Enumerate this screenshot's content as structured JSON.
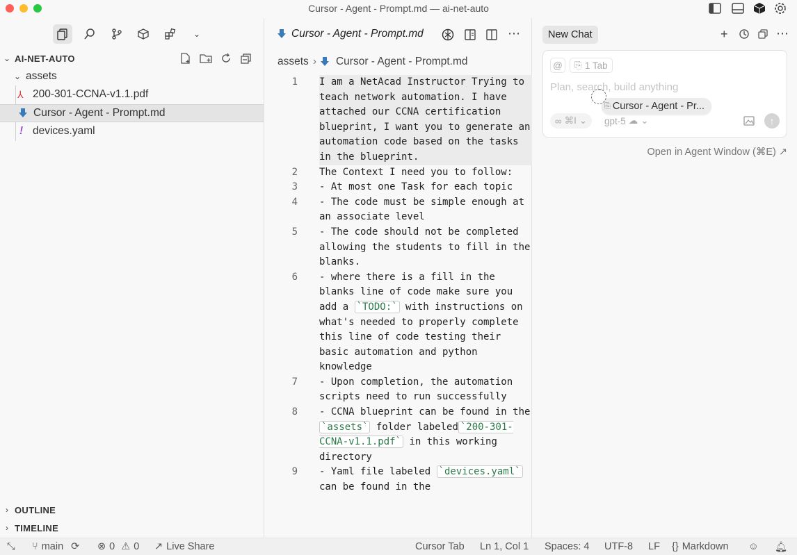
{
  "window": {
    "title": "Cursor - Agent - Prompt.md — ai-net-auto"
  },
  "sidebar": {
    "project": "AI-NET-AUTO",
    "tree": [
      {
        "label": "assets",
        "type": "folder"
      },
      {
        "label": "200-301-CCNA-v1.1.pdf",
        "type": "pdf"
      },
      {
        "label": "Cursor - Agent -  Prompt.md",
        "type": "md"
      },
      {
        "label": "devices.yaml",
        "type": "yaml"
      }
    ],
    "outline": "OUTLINE",
    "timeline": "TIMELINE"
  },
  "editor": {
    "tab_label": "Cursor - Agent - Prompt.md",
    "breadcrumb": {
      "folder": "assets",
      "file": "Cursor - Agent -  Prompt.md"
    },
    "lines": [
      {
        "n": "1",
        "t": "I am a NetAcad Instructor Trying to teach network automation. I have attached our CCNA certification blueprint, I want you to generate an automation code based on the tasks in the blueprint."
      },
      {
        "n": "2",
        "t": "The Context I need you to follow:"
      },
      {
        "n": "3",
        "t": "- At most one Task for each topic"
      },
      {
        "n": "4",
        "t": "- The code must be simple enough at an associate level"
      },
      {
        "n": "5",
        "t": "- The code should not be completed allowing the students to fill in the blanks."
      },
      {
        "n": "6a",
        "t": "- where there is a fill in the blanks line of code make sure you add a "
      },
      {
        "n": "6c",
        "t": "`TODO:`"
      },
      {
        "n": "6b",
        "t": " with instructions on what's needed to properly complete this line of code testing their basic automation and python knowledge"
      },
      {
        "n": "7",
        "t": "- Upon completion, the automation scripts need to run successfully"
      },
      {
        "n": "8a",
        "t": "- CCNA blueprint can be found in the "
      },
      {
        "n": "8c1",
        "t": "`assets`"
      },
      {
        "n": "8b",
        "t": " folder labeled"
      },
      {
        "n": "8c2",
        "t": "`200-301-CCNA-v1.1.pdf`"
      },
      {
        "n": "8d",
        "t": " in this working directory"
      },
      {
        "n": "9a",
        "t": "- Yaml file labeled "
      },
      {
        "n": "9c",
        "t": "`devices.yaml`"
      },
      {
        "n": "9b",
        "t": " can be found in the"
      }
    ],
    "line_numbers": [
      "1",
      "2",
      "3",
      "4",
      "5",
      "6",
      "7",
      "8",
      "9"
    ]
  },
  "chat": {
    "tab_label": "New Chat",
    "at_symbol": "@",
    "tab_chip": "1 Tab",
    "placeholder": "Plan, search, build anything",
    "drag_label": "Cursor - Agent - Pr...",
    "mode_shortcut": "⌘I",
    "model": "gpt-5",
    "open_agent": "Open in Agent Window (⌘E) ↗"
  },
  "status": {
    "branch": "main",
    "errors": "0",
    "warnings": "0",
    "live_share": "Live Share",
    "cursor_tab": "Cursor Tab",
    "position": "Ln 1, Col 1",
    "spaces": "Spaces: 4",
    "encoding": "UTF-8",
    "eol": "LF",
    "language": "Markdown"
  },
  "colors": {
    "pdf": "#d8382f",
    "md": "#3b7ab8",
    "yaml": "#9b4fc8",
    "code_tick": "#2d7a4a"
  }
}
